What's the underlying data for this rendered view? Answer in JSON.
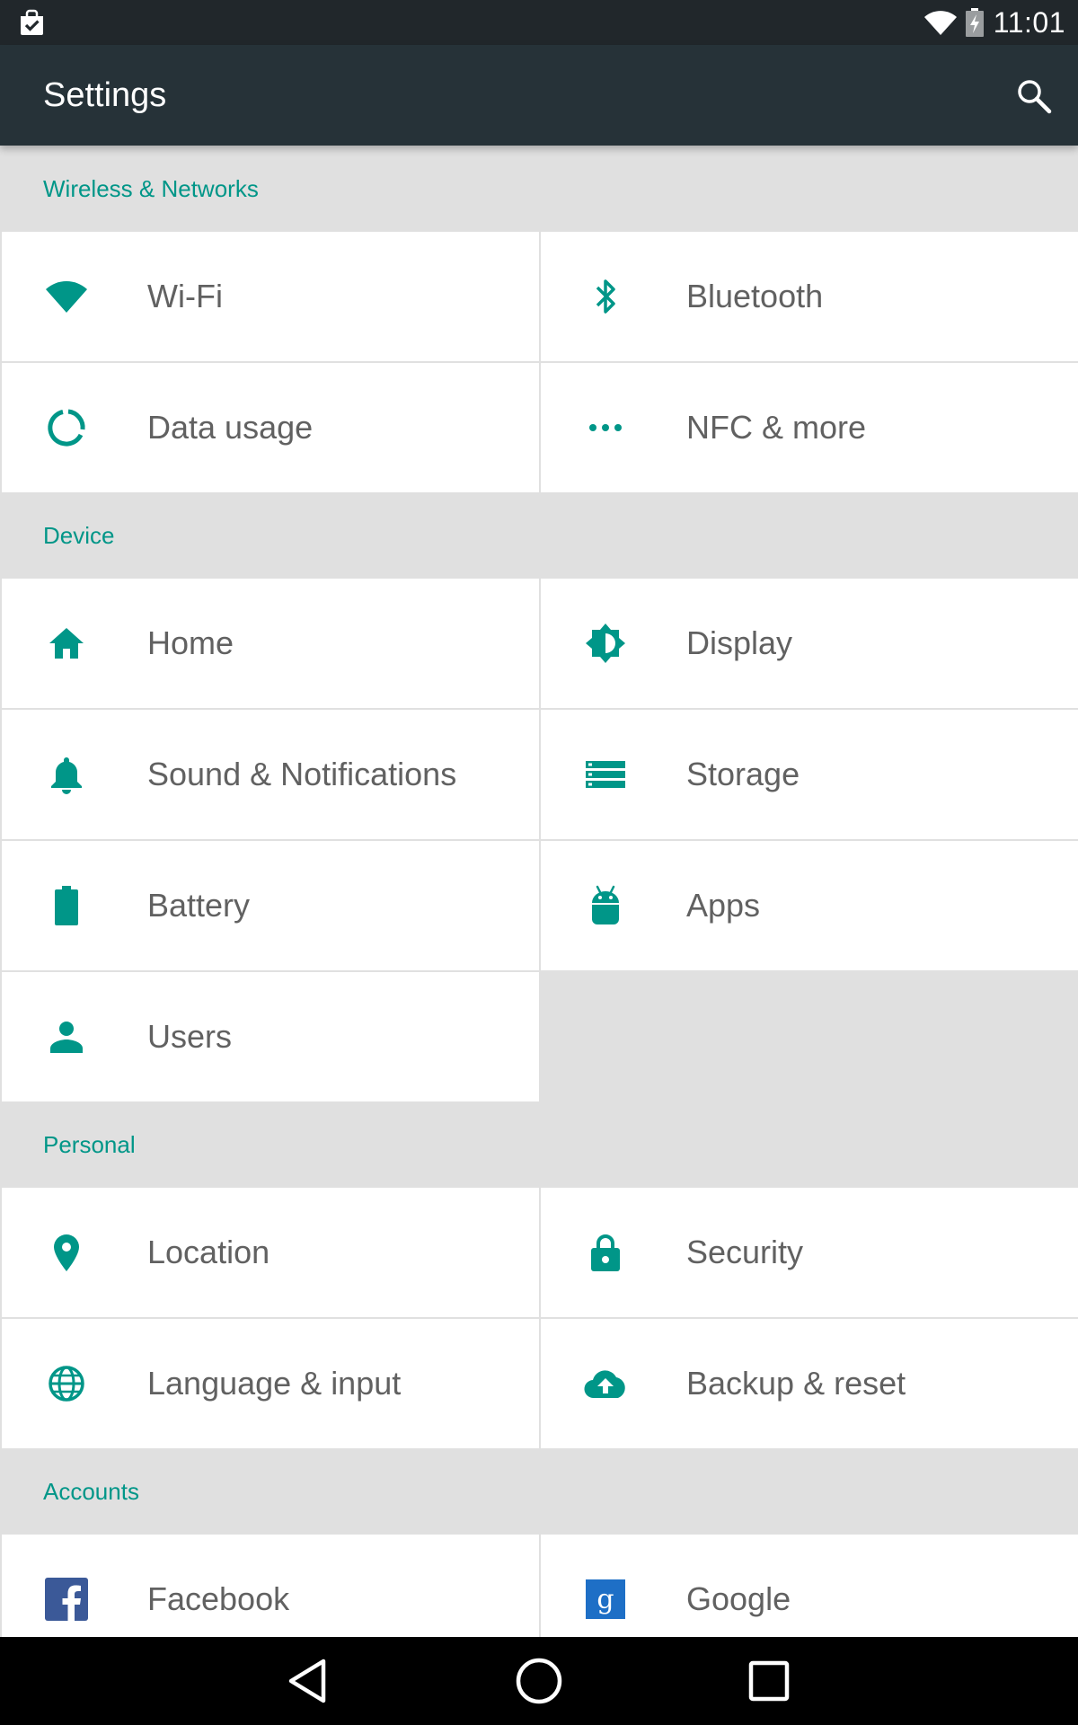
{
  "status_bar": {
    "time": "11:01",
    "icons": [
      "task-notification-icon",
      "wifi-signal-icon",
      "battery-charging-icon"
    ]
  },
  "app_bar": {
    "title": "Settings",
    "search_icon": "search-icon"
  },
  "sections": [
    {
      "header": "Wireless & Networks",
      "items": [
        {
          "label": "Wi-Fi",
          "icon": "wifi-icon"
        },
        {
          "label": "Bluetooth",
          "icon": "bluetooth-icon"
        },
        {
          "label": "Data usage",
          "icon": "data-usage-icon"
        },
        {
          "label": "NFC & more",
          "icon": "more-horiz-icon"
        }
      ]
    },
    {
      "header": "Device",
      "items": [
        {
          "label": "Home",
          "icon": "home-icon"
        },
        {
          "label": "Display",
          "icon": "brightness-icon"
        },
        {
          "label": "Sound & Notifications",
          "icon": "bell-icon"
        },
        {
          "label": "Storage",
          "icon": "storage-icon"
        },
        {
          "label": "Battery",
          "icon": "battery-icon"
        },
        {
          "label": "Apps",
          "icon": "android-icon"
        },
        {
          "label": "Users",
          "icon": "person-icon"
        }
      ]
    },
    {
      "header": "Personal",
      "items": [
        {
          "label": "Location",
          "icon": "location-pin-icon"
        },
        {
          "label": "Security",
          "icon": "lock-icon"
        },
        {
          "label": "Language & input",
          "icon": "globe-icon"
        },
        {
          "label": "Backup & reset",
          "icon": "cloud-upload-icon"
        }
      ]
    },
    {
      "header": "Accounts",
      "items": [
        {
          "label": "Facebook",
          "icon": "facebook-icon"
        },
        {
          "label": "Google",
          "icon": "google-icon"
        }
      ]
    }
  ],
  "nav_bar": {
    "buttons": [
      "back-icon",
      "home-circle-icon",
      "recents-icon"
    ]
  },
  "colors": {
    "accent": "#009688",
    "app_bar": "#263238",
    "status_bar": "#21272b",
    "background": "#e0e0e0",
    "tile": "#ffffff",
    "label_text": "#616161",
    "facebook_blue": "#3b5998",
    "google_blue": "#1e6fc6"
  }
}
